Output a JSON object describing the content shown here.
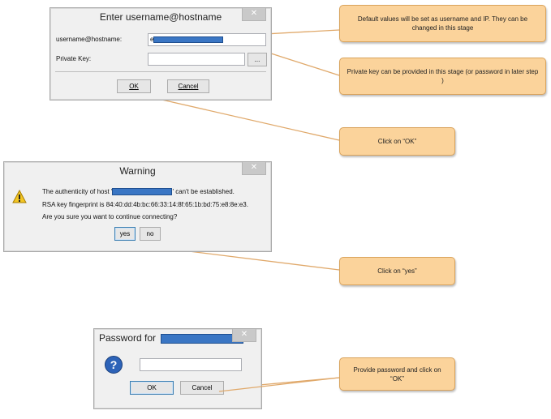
{
  "dialog1": {
    "title": "Enter username@hostname",
    "close_glyph": "✕",
    "username_label": "username@hostname:",
    "username_value_prefix": "e",
    "private_key_label": "Private Key:",
    "browse_label": "...",
    "ok_label": "OK",
    "cancel_label": "Cancel"
  },
  "dialog2": {
    "title": "Warning",
    "close_glyph": "✕",
    "icon": "warning-triangle-icon",
    "line1_prefix": "The authenticity of host '",
    "line1_suffix": "' can't be established.",
    "line2": "RSA key fingerprint is 84:40:dd:4b:bc:66:33:14:8f:65:1b:bd:75:e8:8e:e3.",
    "line3": "Are you sure you want to continue connecting?",
    "yes_label": "yes",
    "no_label": "no"
  },
  "dialog3": {
    "title_prefix": "Password for",
    "close_glyph": "✕",
    "icon": "question-icon",
    "ok_label": "OK",
    "cancel_label": "Cancel"
  },
  "callouts": {
    "c1": "Default values will be set as username and IP. They can be changed in this stage",
    "c2": "Private key can be provided in this stage (or password in later step )",
    "c3": "Click on “OK”",
    "c4": "Click on “yes”",
    "c5": "Provide password and click on “OK”"
  },
  "colors": {
    "callout_fill": "#fbd39b",
    "callout_border": "#d9a35c",
    "redaction": "#3a76c4"
  }
}
